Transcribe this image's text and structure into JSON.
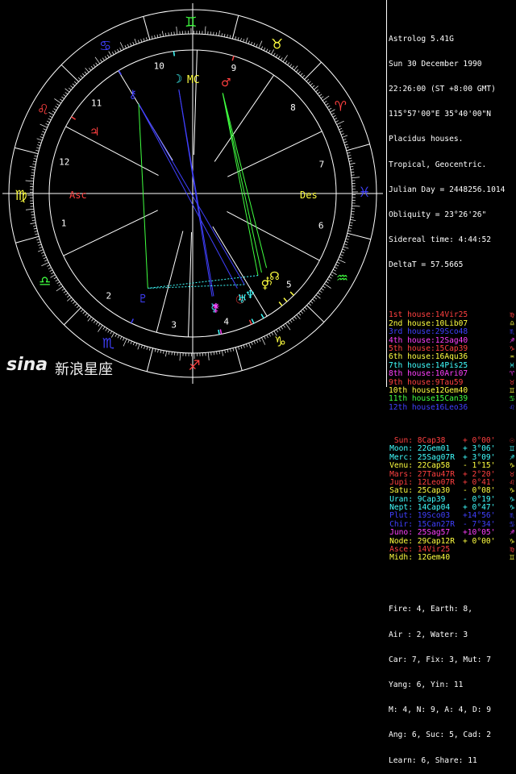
{
  "header": {
    "lines": [
      "Astrolog 5.41G",
      "Sun 30 December 1990",
      "22:26:00 (ST +8:00 GMT)",
      "115°57'00\"E 35°40'00\"N",
      "Placidus houses.",
      "Tropical, Geocentric.",
      "Julian Day = 2448256.1014",
      "Obliquity = 23°26'26\"",
      "Sidereal time: 4:44:52",
      "DeltaT = 57.5665"
    ]
  },
  "houses": [
    {
      "label": "1st house:",
      "pos": "14Vir25",
      "color": "#ff4040",
      "glyph": "♍"
    },
    {
      "label": "2nd house:",
      "pos": "10Lib07",
      "color": "#ffff40",
      "glyph": "♎"
    },
    {
      "label": "3rd house:",
      "pos": "29Sco48",
      "color": "#4040ff",
      "glyph": "♏"
    },
    {
      "label": "4th house:",
      "pos": "12Sag40",
      "color": "#ff40ff",
      "glyph": "♐"
    },
    {
      "label": "5th house:",
      "pos": "15Cap39",
      "color": "#ff4040",
      "glyph": "♑"
    },
    {
      "label": "6th house:",
      "pos": "16Aqu36",
      "color": "#ffff40",
      "glyph": "♒"
    },
    {
      "label": "7th house:",
      "pos": "14Pis25",
      "color": "#40ffff",
      "glyph": "♓"
    },
    {
      "label": "8th house:",
      "pos": "10Ari07",
      "color": "#ff40ff",
      "glyph": "♈"
    },
    {
      "label": "9th house:",
      "pos": "9Tau59",
      "color": "#ff4040",
      "glyph": "♉"
    },
    {
      "label": "10th house:",
      "pos": "12Gem40",
      "color": "#ffff40",
      "glyph": "♊"
    },
    {
      "label": "11th house:",
      "pos": "15Can39",
      "color": "#40ff40",
      "glyph": "♋"
    },
    {
      "label": "12th house:",
      "pos": "16Leo36",
      "color": "#4040ff",
      "glyph": "♌"
    }
  ],
  "planets": [
    {
      "name": "Sun:",
      "pos": "8Cap38",
      "lat": "+ 0°00'",
      "color": "#ff4040",
      "glyph": "☉"
    },
    {
      "name": "Moon:",
      "pos": "22Gem01",
      "lat": "+ 3°06'",
      "color": "#40ffff",
      "glyph": "♊"
    },
    {
      "name": "Merc:",
      "pos": "25Sag07R",
      "lat": "+ 3°09'",
      "color": "#40ffff",
      "glyph": "♐"
    },
    {
      "name": "Venu:",
      "pos": "22Cap58",
      "lat": "- 1°15'",
      "color": "#ffff40",
      "glyph": "♑"
    },
    {
      "name": "Mars:",
      "pos": "27Tau47R",
      "lat": "+ 2°20'",
      "color": "#ff4040",
      "glyph": "♉"
    },
    {
      "name": "Jupi:",
      "pos": "12Leo07R",
      "lat": "+ 0°41'",
      "color": "#ff4040",
      "glyph": "♌"
    },
    {
      "name": "Satu:",
      "pos": "25Cap30",
      "lat": "- 0°08'",
      "color": "#ffff40",
      "glyph": "♑"
    },
    {
      "name": "Uran:",
      "pos": "9Cap39",
      "lat": "- 0°19'",
      "color": "#40ffff",
      "glyph": "♑"
    },
    {
      "name": "Nept:",
      "pos": "14Cap04",
      "lat": "+ 0°47'",
      "color": "#40ffff",
      "glyph": "♑"
    },
    {
      "name": "Plut:",
      "pos": "19Sco03",
      "lat": "+14°56'",
      "color": "#4040ff",
      "glyph": "♏"
    },
    {
      "name": "Chir:",
      "pos": "15Can27R",
      "lat": "- 7°34'",
      "color": "#4040ff",
      "glyph": "♋"
    },
    {
      "name": "Juno:",
      "pos": "25Sag57",
      "lat": "+10°05'",
      "color": "#ff40ff",
      "glyph": "♐"
    },
    {
      "name": "Node:",
      "pos": "29Cap12R",
      "lat": "+ 0°00'",
      "color": "#ffff40",
      "glyph": "♑"
    },
    {
      "name": "Asce:",
      "pos": "14Vir25",
      "lat": "",
      "color": "#ff4040",
      "glyph": "♍"
    },
    {
      "name": "Midh:",
      "pos": "12Gem40",
      "lat": "",
      "color": "#ffff40",
      "glyph": "♊"
    }
  ],
  "footer": {
    "lines": [
      "Fire: 4, Earth: 8,",
      "Air : 2, Water: 3",
      "Car: 7, Fix: 3, Mut: 7",
      "Yang: 6, Yin: 11",
      "M: 4, N: 9, A: 4, D: 9",
      "Ang: 6, Suc: 5, Cad: 2",
      "Learn: 6, Share: 11"
    ]
  },
  "wheel": {
    "signs": [
      {
        "glyph": "♈",
        "color": "#ff4040"
      },
      {
        "glyph": "♉",
        "color": "#ffff40"
      },
      {
        "glyph": "♊",
        "color": "#40ff40"
      },
      {
        "glyph": "♋",
        "color": "#4040ff"
      },
      {
        "glyph": "♌",
        "color": "#ff4040"
      },
      {
        "glyph": "♍",
        "color": "#ffff40"
      },
      {
        "glyph": "♎",
        "color": "#40ff40"
      },
      {
        "glyph": "♏",
        "color": "#4040ff"
      },
      {
        "glyph": "♐",
        "color": "#ff4040"
      },
      {
        "glyph": "♑",
        "color": "#ffff40"
      },
      {
        "glyph": "♒",
        "color": "#40ff40"
      },
      {
        "glyph": "♓",
        "color": "#4040ff"
      }
    ],
    "house_numbers": [
      "1",
      "2",
      "3",
      "4",
      "5",
      "6",
      "7",
      "8",
      "9",
      "10",
      "11",
      "12"
    ],
    "labels": {
      "asc": "Asc",
      "des": "Des",
      "mc": "MC",
      "ic": "IC"
    }
  },
  "watermark": {
    "logo": "sina",
    "text": "新浪星座"
  }
}
